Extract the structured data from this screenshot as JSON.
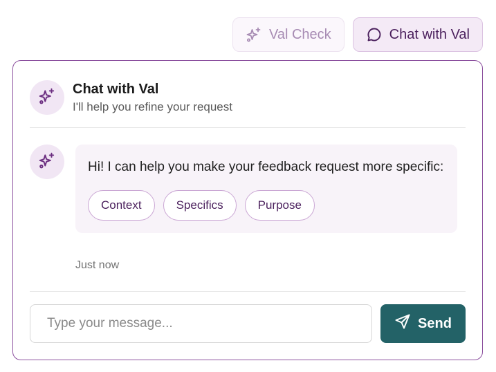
{
  "toggles": {
    "val_check": {
      "label": "Val Check",
      "icon": "sparkle-icon",
      "state": "inactive"
    },
    "chat_with_val": {
      "label": "Chat with Val",
      "icon": "chat-bubble-icon",
      "state": "active"
    }
  },
  "chat": {
    "title": "Chat with Val",
    "subtitle": "I'll help you refine your request",
    "messages": [
      {
        "sender_icon": "sparkle-icon",
        "text": "Hi! I can help you make your feedback request more specific:",
        "chips": [
          "Context",
          "Specifics",
          "Purpose"
        ],
        "timestamp": "Just now"
      }
    ],
    "input": {
      "placeholder": "Type your message...",
      "value": ""
    },
    "send": {
      "label": "Send",
      "icon": "send-icon"
    }
  },
  "colors": {
    "accent": "#8b4f9e",
    "accent_dark": "#4a1f5c",
    "send_button": "#236267",
    "bubble_bg": "#f8f3f9",
    "avatar_bg": "#f1e6f4"
  }
}
